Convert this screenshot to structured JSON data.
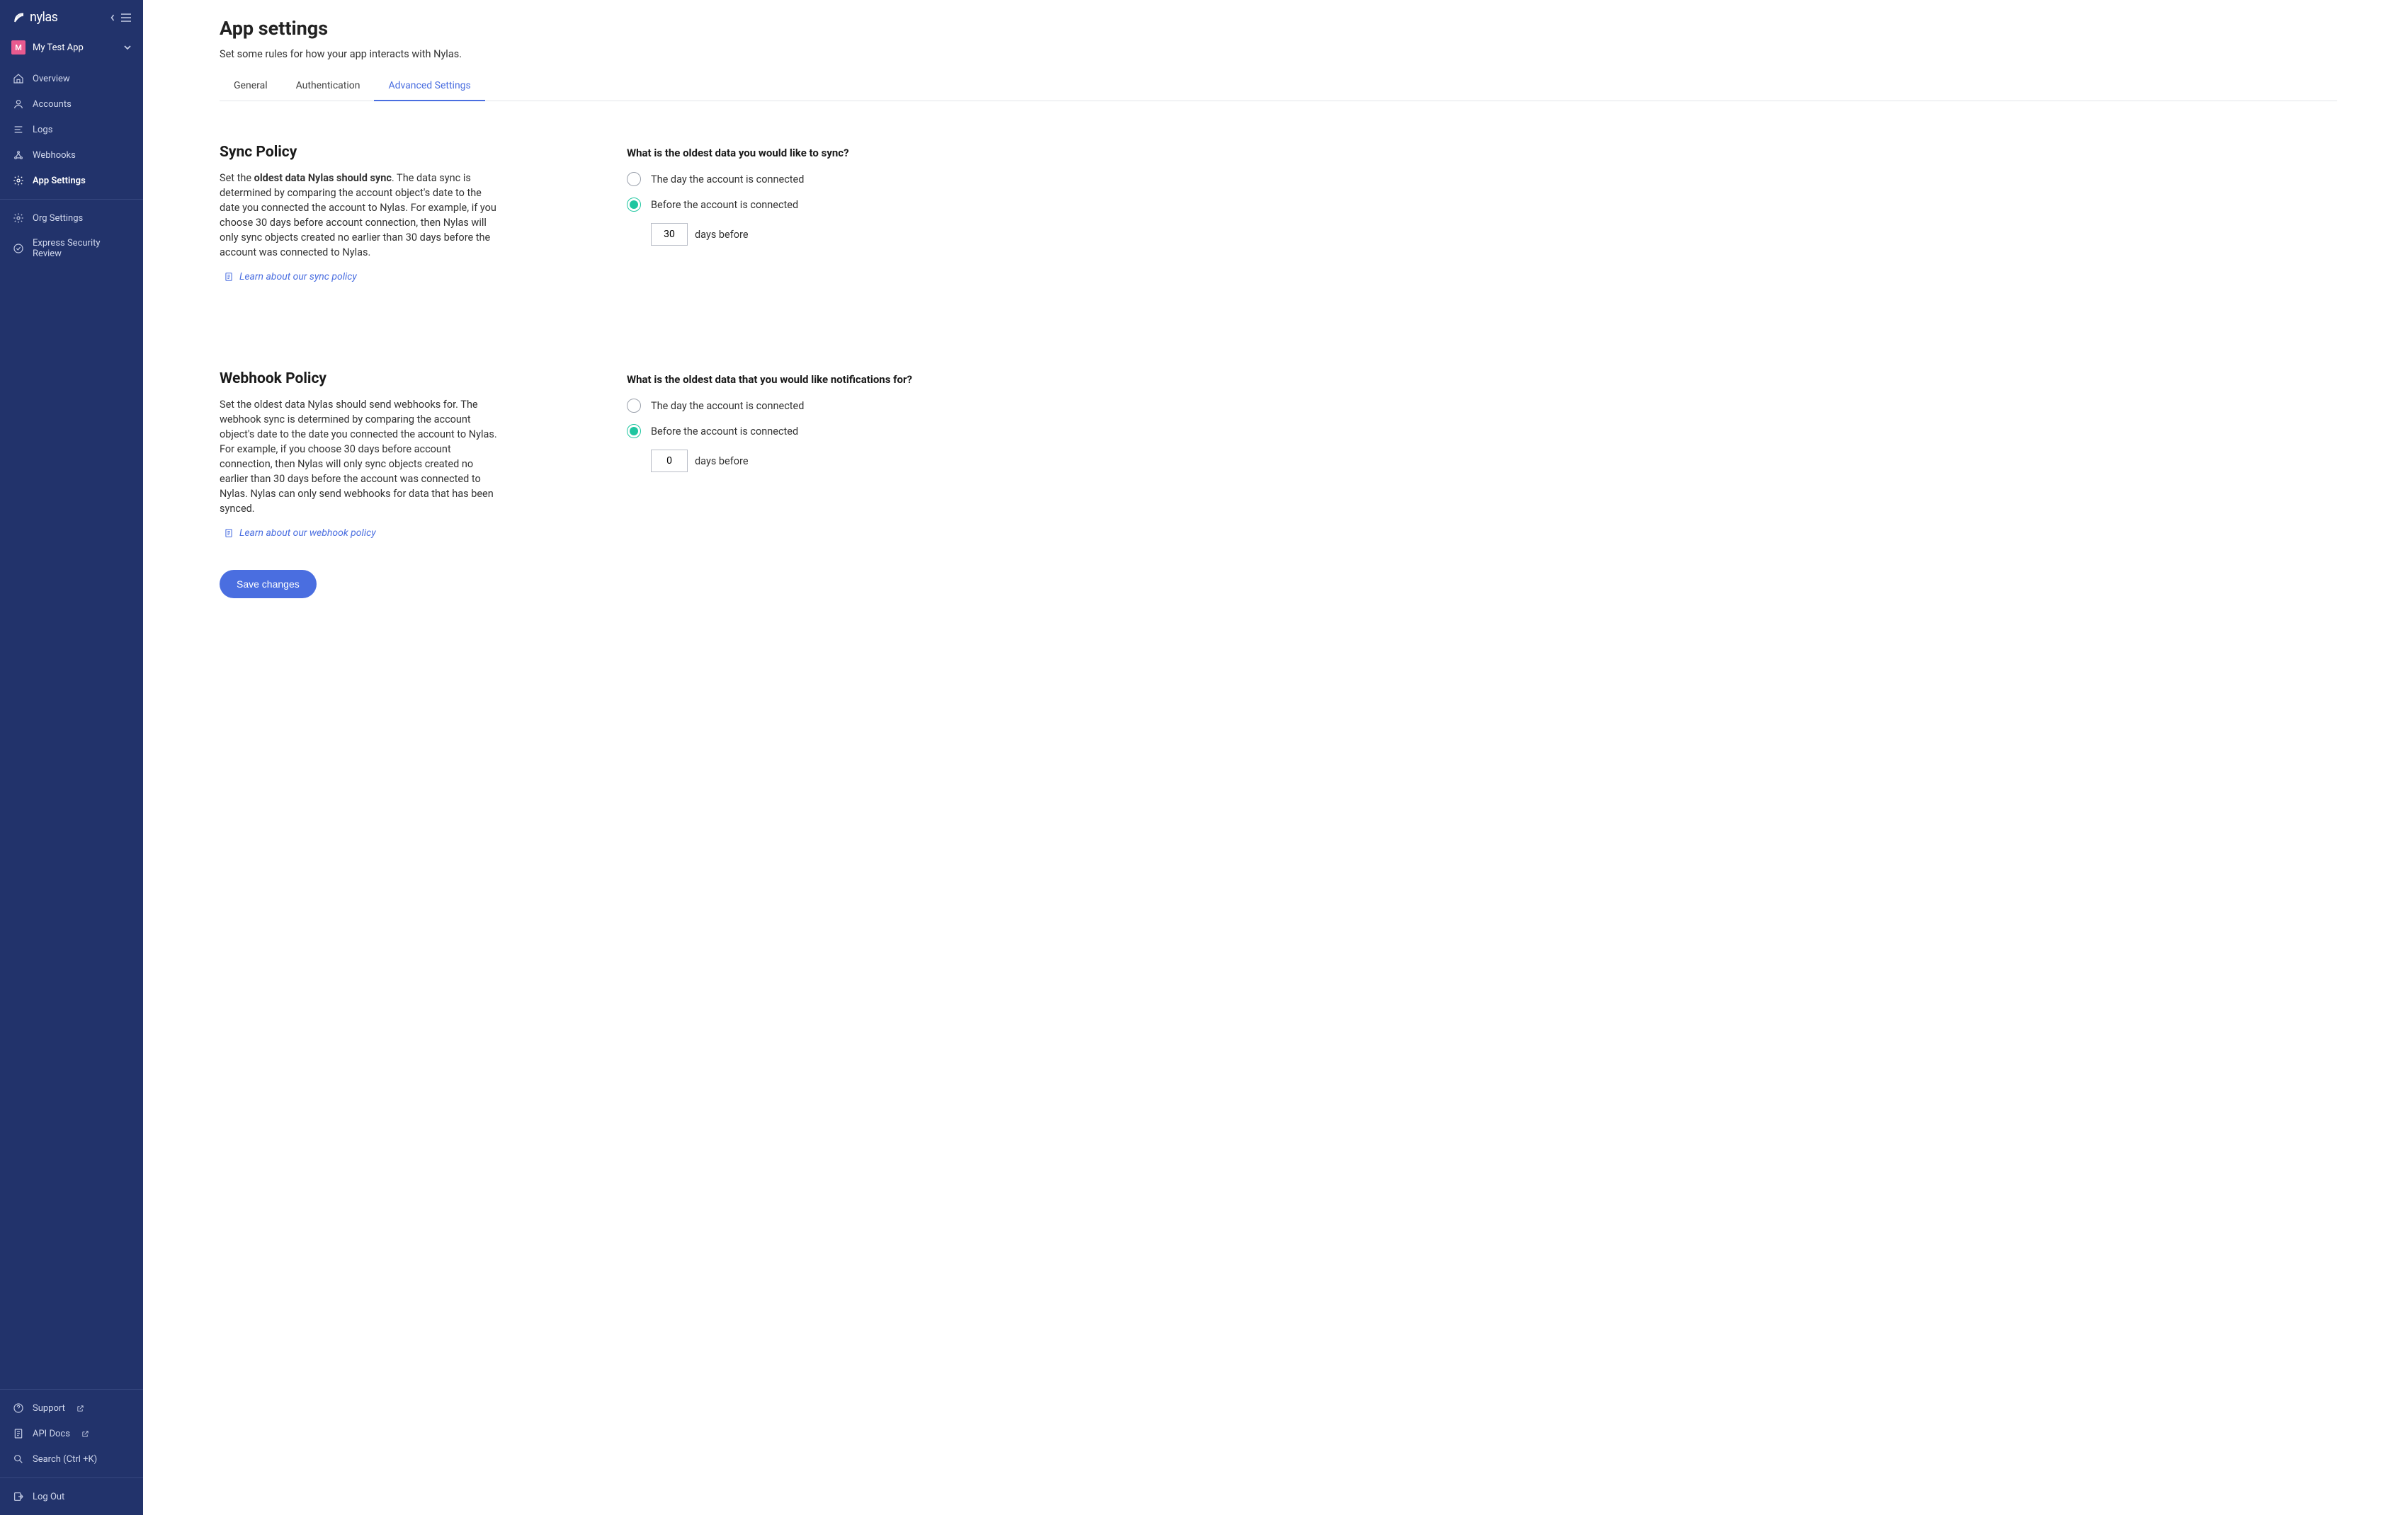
{
  "brand": "nylas",
  "app_switcher": {
    "avatar_letter": "M",
    "name": "My Test App"
  },
  "sidebar": {
    "nav1": [
      {
        "label": "Overview",
        "icon": "home"
      },
      {
        "label": "Accounts",
        "icon": "user"
      },
      {
        "label": "Logs",
        "icon": "logs"
      },
      {
        "label": "Webhooks",
        "icon": "webhook"
      },
      {
        "label": "App Settings",
        "icon": "gear",
        "active": true
      }
    ],
    "nav2": [
      {
        "label": "Org Settings",
        "icon": "gear"
      },
      {
        "label": "Express Security Review",
        "icon": "shield-check"
      }
    ],
    "footer": {
      "support": "Support",
      "apidocs": "API Docs",
      "search": "Search (Ctrl +K)",
      "logout": "Log Out"
    }
  },
  "page": {
    "title": "App settings",
    "subtitle": "Set some rules for how your app interacts with Nylas."
  },
  "tabs": [
    {
      "label": "General"
    },
    {
      "label": "Authentication"
    },
    {
      "label": "Advanced Settings",
      "active": true
    }
  ],
  "sync": {
    "title": "Sync Policy",
    "desc_pre": "Set the ",
    "desc_bold": "oldest data Nylas should sync",
    "desc_post": ". The data sync is determined by comparing the account object's date to the date you connected the account to Nylas. For example, if you choose 30 days before account connection, then Nylas will only sync objects created no earlier than 30 days before the account was connected to Nylas.",
    "learn": "Learn about our sync policy",
    "question": "What is the oldest data you would like to sync?",
    "opt1": "The day the account is connected",
    "opt2": "Before the account is connected",
    "selected": "before",
    "days_value": "30",
    "days_suffix": "days before"
  },
  "webhook": {
    "title": "Webhook Policy",
    "desc": "Set the oldest data Nylas should send webhooks for. The webhook sync is determined by comparing the account object's date to the date you connected the account to Nylas. For example, if you choose 30 days before account connection, then Nylas will only sync objects created no earlier than 30 days before the account was connected to Nylas. Nylas can only send webhooks for data that has been synced.",
    "learn": "Learn about our webhook policy",
    "question": "What is the oldest data that you would like notifications for?",
    "opt1": "The day the account is connected",
    "opt2": "Before the account is connected",
    "selected": "before",
    "days_value": "0",
    "days_suffix": "days before"
  },
  "save": "Save changes"
}
